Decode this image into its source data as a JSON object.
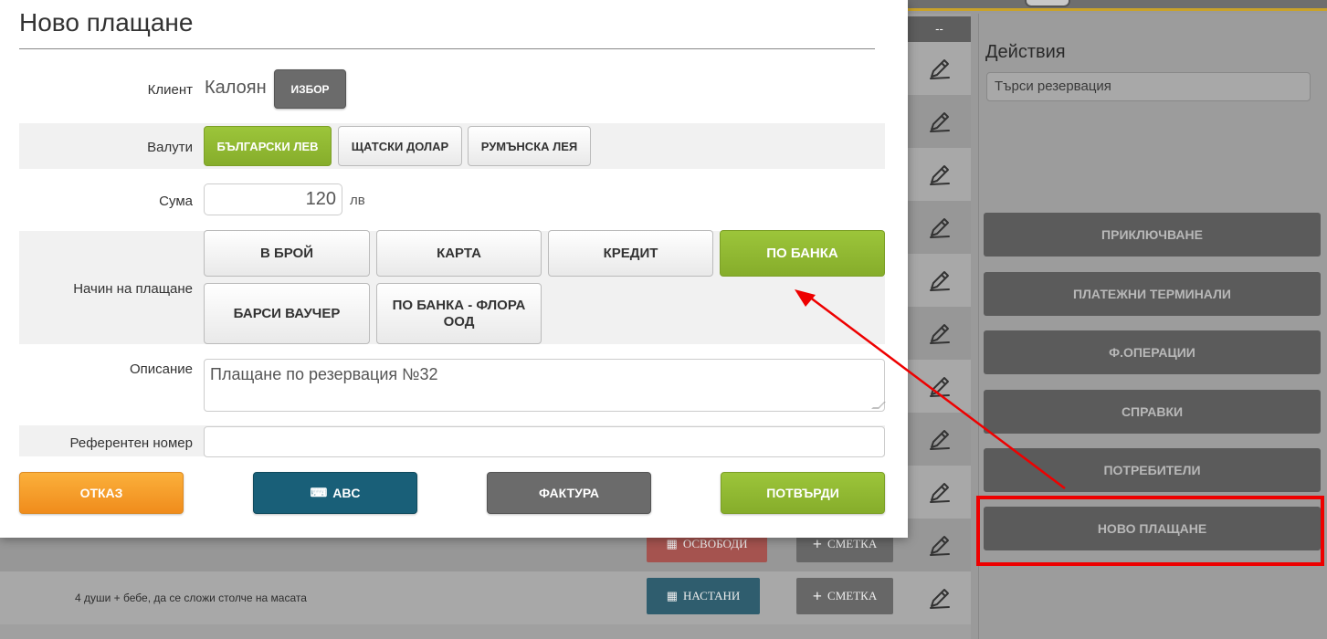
{
  "colors": {
    "accent_green": "#8fba33",
    "cancel_orange": "#f59c2b",
    "keyboard_teal": "#195f78",
    "neutral_gray": "#6b6b6b",
    "annotation_red": "#ee0000"
  },
  "modal": {
    "title": "Ново плащане",
    "client": {
      "label": "Клиент",
      "value": "Калоян",
      "select_button": "ИЗБОР"
    },
    "currencies": {
      "label": "Валути",
      "options": [
        "БЪЛГАРСКИ ЛЕВ",
        "ЩАТСКИ ДОЛАР",
        "РУМЪНСКА ЛЕЯ"
      ],
      "selected": "БЪЛГАРСКИ ЛЕВ"
    },
    "amount": {
      "label": "Сума",
      "value": "120",
      "unit": "лв"
    },
    "payment_method": {
      "label": "Начин на плащане",
      "options": [
        "В БРОЙ",
        "КАРТА",
        "КРЕДИТ",
        "ПО БАНКА",
        "БАРСИ ВАУЧЕР",
        "ПО БАНКА - ФЛОРА ООД"
      ],
      "selected": "ПО БАНКА"
    },
    "description": {
      "label": "Описание",
      "value": "Плащане по резервация №32"
    },
    "reference": {
      "label": "Референтен номер",
      "value": ""
    },
    "actions": {
      "cancel": "ОТКАЗ",
      "keyboard": "ABC",
      "invoice": "ФАКТУРА",
      "confirm": "ПОТВЪРДИ"
    }
  },
  "background": {
    "table_header": "--",
    "note": "4 души + бебе, да се сложи столче на масата",
    "row_buttons": {
      "free": "ОСВОБОДИ",
      "seat": "НАСТАНИ",
      "bill": "СМЕТКА"
    }
  },
  "actions_panel": {
    "title": "Действия",
    "search_placeholder": "Търси резервация",
    "buttons": [
      "ПРИКЛЮЧВАНЕ",
      "ПЛАТЕЖНИ ТЕРМИНАЛИ",
      "Ф.ОПЕРАЦИИ",
      "СПРАВКИ",
      "ПОТРЕБИТЕЛИ",
      "НОВО ПЛАЩАНЕ"
    ],
    "highlighted": "НОВО ПЛАЩАНЕ"
  }
}
